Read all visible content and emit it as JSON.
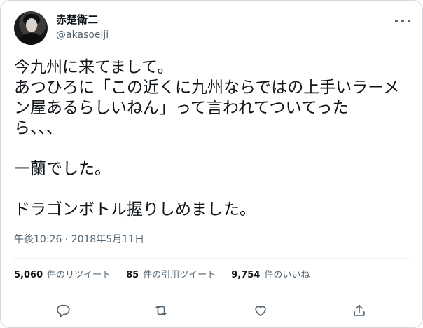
{
  "author": {
    "display_name": "赤楚衛二",
    "handle": "@akasoeiji"
  },
  "tweet": {
    "lines": [
      "今九州に来てまして。",
      "あつひろに「この近くに九州ならではの上手いラーメ",
      "ン屋あるらしいねん」って言われてついてった",
      "ら、、、",
      "",
      "一蘭でした。",
      "",
      "ドラゴンボトル握りしめました。"
    ],
    "timestamp": "午後10:26 · 2018年5月11日"
  },
  "stats": {
    "retweets_count": "5,060",
    "retweets_label": "件のリツイート",
    "quotes_count": "85",
    "quotes_label": "件の引用ツイート",
    "likes_count": "9,754",
    "likes_label": "件のいいね"
  },
  "icons": {
    "more": "more-horizontal-icon",
    "reply": "reply-icon",
    "retweet": "retweet-icon",
    "like": "heart-icon",
    "share": "share-icon"
  },
  "colors": {
    "text": "#0f1419",
    "secondary": "#536471",
    "border": "#cfd9de",
    "divider": "#eff3f4"
  }
}
